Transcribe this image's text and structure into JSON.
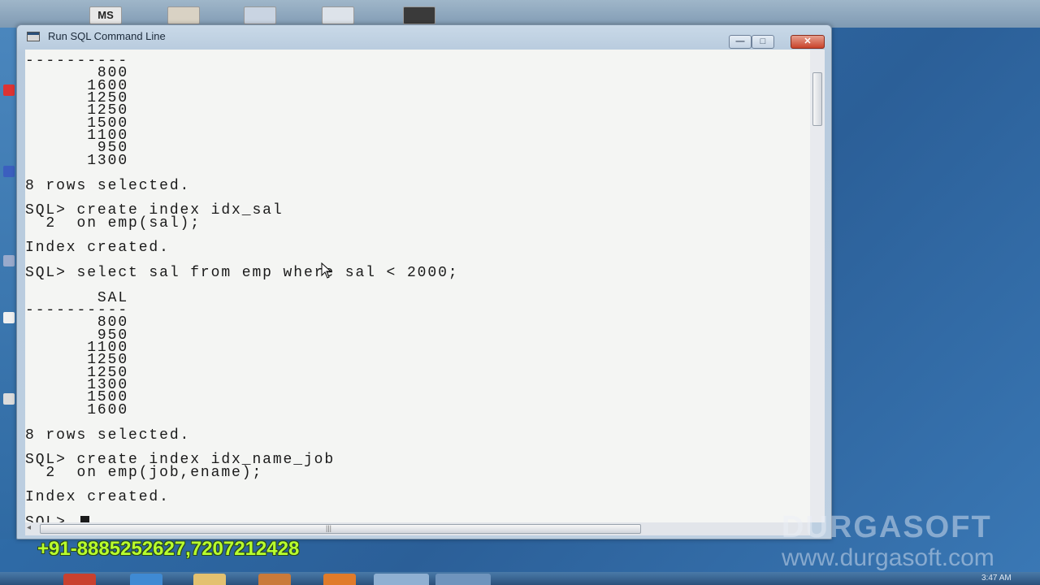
{
  "window": {
    "title": "Run SQL Command Line",
    "minimize_glyph": "—",
    "maximize_glyph": "□",
    "close_glyph": "✕"
  },
  "console_lines": [
    "----------",
    "       800",
    "      1600",
    "      1250",
    "      1250",
    "      1500",
    "      1100",
    "       950",
    "      1300",
    "",
    "8 rows selected.",
    "",
    "SQL> create index idx_sal",
    "  2  on emp(sal);",
    "",
    "Index created.",
    "",
    "SQL> select sal from emp where sal < 2000;",
    "",
    "       SAL",
    "----------",
    "       800",
    "       950",
    "      1100",
    "      1250",
    "      1250",
    "      1300",
    "      1500",
    "      1600",
    "",
    "8 rows selected.",
    "",
    "SQL> create index idx_name_job",
    "  2  on emp(job,ename);",
    "",
    "Index created.",
    "",
    "SQL> "
  ],
  "desktop": {
    "top_icon_label": "MS"
  },
  "watermark": {
    "brand": "DURGASOFT",
    "url": "www.durgasoft.com",
    "phone": "+91-8885252627,7207212428"
  },
  "taskbar": {
    "clock": "3:47 AM"
  }
}
